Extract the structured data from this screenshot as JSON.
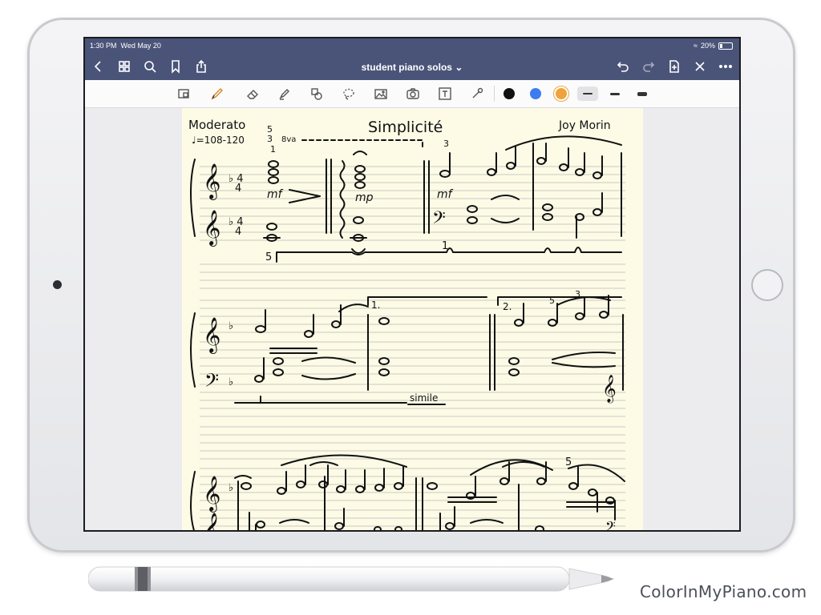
{
  "status": {
    "time": "1:30 PM",
    "date": "Wed May 20",
    "battery": "20%"
  },
  "document": {
    "title": "student piano solos",
    "title_suffix": "⌄"
  },
  "nav": {
    "left_icons": [
      "back-icon",
      "grid-icon",
      "search-icon",
      "bookmark-icon",
      "share-icon"
    ],
    "right_icons": [
      "undo-icon",
      "redo-icon",
      "add-page-icon",
      "close-icon",
      "more-icon"
    ]
  },
  "toolbar": {
    "tools": [
      "zoom-window-icon",
      "pen-icon",
      "eraser-icon",
      "highlighter-icon",
      "shapes-icon",
      "lasso-icon",
      "image-icon",
      "camera-icon",
      "text-icon",
      "laser-pointer-icon"
    ],
    "active_tool": "pen-icon",
    "colors": [
      "#111111",
      "#3b7cf0",
      "#f0a23c"
    ],
    "selected_color_index": 2,
    "stroke_widths": [
      "thin",
      "medium",
      "thick"
    ],
    "selected_stroke_index": 0
  },
  "sheet": {
    "tempo": "Moderato",
    "metronome": "♩=108-120",
    "piece_title": "Simplicité",
    "composer": "Joy Morin",
    "dynamics": [
      "mf",
      "mp",
      "mf"
    ],
    "fingerings": [
      "5",
      "3",
      "1",
      "3",
      "5",
      "1",
      "5",
      "3",
      "5"
    ],
    "ottava": "8va",
    "endings": [
      "1.",
      "2."
    ],
    "simile": "simile"
  },
  "brand": "ColorInMyPiano.com"
}
